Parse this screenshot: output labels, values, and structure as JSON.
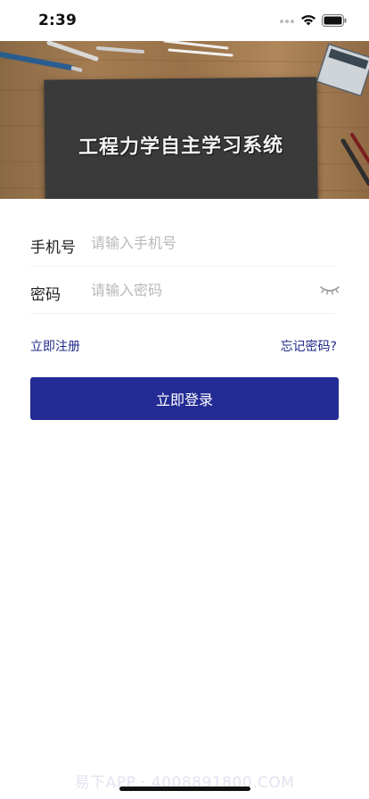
{
  "status_bar": {
    "time": "2:39"
  },
  "banner": {
    "title": "工程力学自主学习系统"
  },
  "form": {
    "phone": {
      "label": "手机号",
      "placeholder": "请输入手机号",
      "value": ""
    },
    "password": {
      "label": "密码",
      "placeholder": "请输入密码",
      "value": ""
    }
  },
  "links": {
    "register": "立即注册",
    "forgot": "忘记密码?"
  },
  "login_button": {
    "label": "立即登录"
  },
  "watermark": {
    "text": "易下APP · 4008891800.COM"
  },
  "colors": {
    "primary": "#232b94",
    "link": "#1f2a8a",
    "placeholder": "#b8b8b8"
  },
  "icons": {
    "eye_toggle": "eye-closed-icon",
    "wifi": "wifi-icon",
    "battery": "battery-icon"
  }
}
